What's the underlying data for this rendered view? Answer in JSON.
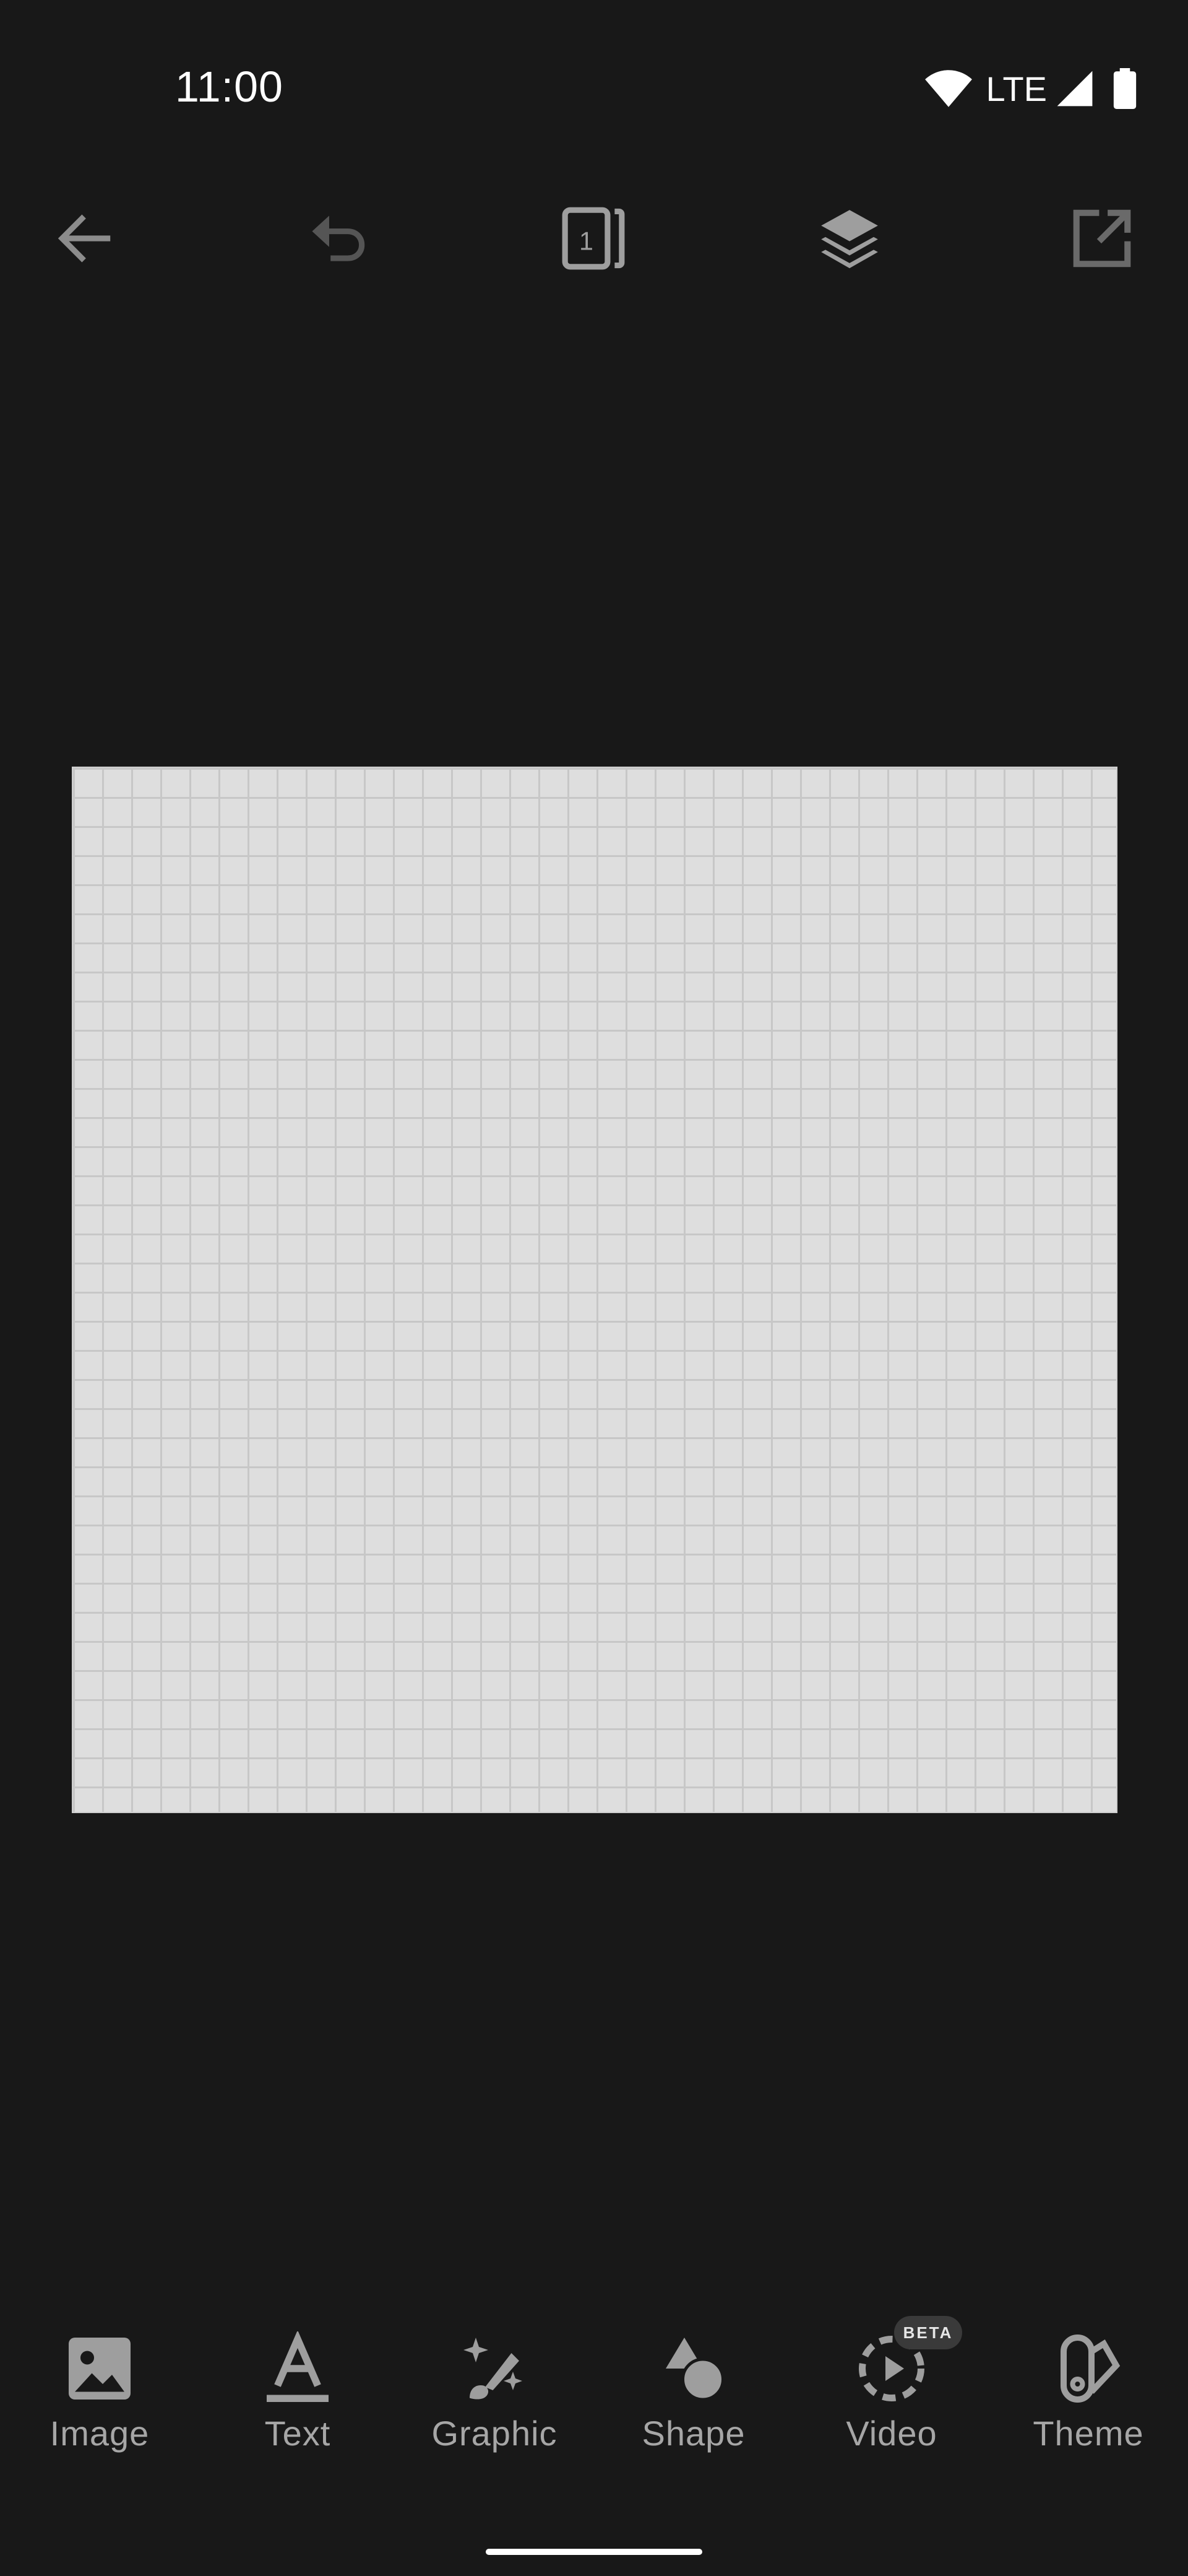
{
  "status_bar": {
    "time": "11:00",
    "network": "LTE",
    "icons": [
      "wifi-icon",
      "signal-icon",
      "battery-icon"
    ]
  },
  "toolbar": {
    "buttons": [
      {
        "name": "back",
        "icon": "arrow-left-icon"
      },
      {
        "name": "undo",
        "icon": "undo-icon"
      },
      {
        "name": "pages",
        "icon": "pages-icon",
        "count": "1"
      },
      {
        "name": "layers",
        "icon": "layers-icon"
      },
      {
        "name": "export",
        "icon": "export-icon"
      }
    ]
  },
  "canvas": {
    "background": "#dedede",
    "grid_color": "#c7c7c7"
  },
  "bottom_tools": {
    "items": [
      {
        "label": "Image",
        "icon": "image-icon"
      },
      {
        "label": "Text",
        "icon": "text-icon"
      },
      {
        "label": "Graphic",
        "icon": "graphic-icon"
      },
      {
        "label": "Shape",
        "icon": "shape-icon"
      },
      {
        "label": "Video",
        "icon": "video-icon",
        "badge": "BETA"
      },
      {
        "label": "Theme",
        "icon": "theme-icon"
      }
    ]
  },
  "colors": {
    "background": "#181818",
    "icon_gray": "#9e9e9e",
    "label_gray": "#a6a6a6"
  }
}
